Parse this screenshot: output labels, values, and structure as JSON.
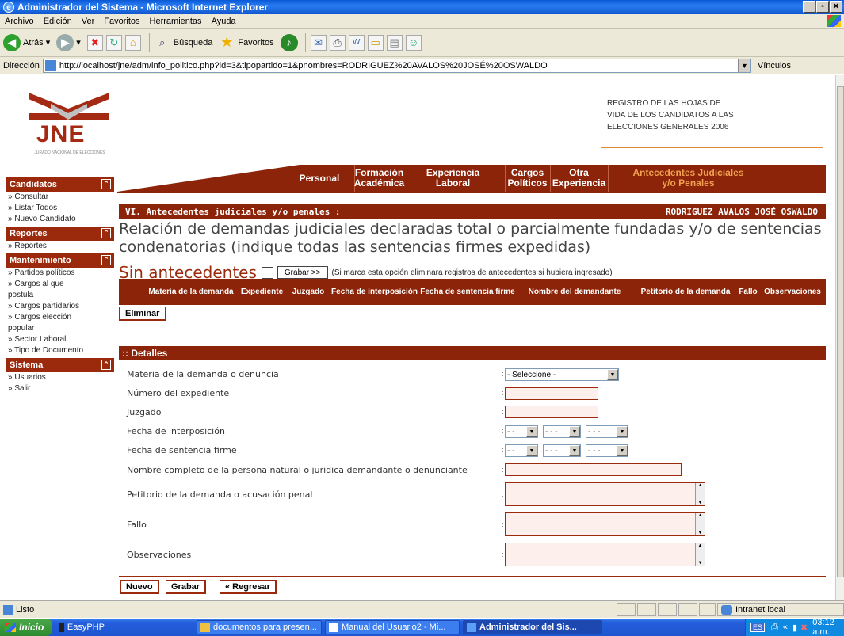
{
  "window": {
    "title": "Administrador del Sistema - Microsoft Internet Explorer"
  },
  "menu": [
    "Archivo",
    "Edición",
    "Ver",
    "Favoritos",
    "Herramientas",
    "Ayuda"
  ],
  "toolbar": {
    "back": "Atrás",
    "search": "Búsqueda",
    "favorites": "Favoritos"
  },
  "address": {
    "label": "Dirección",
    "url": "http://localhost/jne/adm/info_politico.php?id=3&tipopartido=1&pnombres=RODRIGUEZ%20AVALOS%20JOSÉ%20OSWALDO",
    "links": "Vínculos"
  },
  "header": {
    "logo_text": "JNE",
    "logo_sub": "JURADO NACIONAL DE ELECCIONES",
    "registro_1": "REGISTRO DE LAS HOJAS DE",
    "registro_2": "VIDA DE LOS CANDIDATOS A LAS",
    "registro_3": "ELECCIONES GENERALES 2006"
  },
  "sidebar": {
    "candidatos": {
      "title": "Candidatos",
      "items": [
        "» Consultar",
        "» Listar Todos",
        "» Nuevo Candidato"
      ]
    },
    "reportes": {
      "title": "Reportes",
      "items": [
        "» Reportes"
      ]
    },
    "mantenimiento": {
      "title": "Mantenimiento",
      "items": [
        "» Partidos políticos",
        "» Cargos al que",
        "postula",
        "» Cargos partidarios",
        "» Cargos elección",
        "popular",
        "» Sector Laboral",
        "» Tipo de Documento"
      ]
    },
    "sistema": {
      "title": "Sistema",
      "items": [
        "» Usuarios",
        "» Salir"
      ]
    }
  },
  "tabs": {
    "personal": "Personal",
    "formacion_1": "Formación",
    "formacion_2": "Académica",
    "experiencia_1": "Experiencia",
    "experiencia_2": "Laboral",
    "cargos_1": "Cargos",
    "cargos_2": "Políticos",
    "otra_1": "Otra",
    "otra_2": "Experiencia",
    "antecedentes_1": "Antecedentes Judiciales",
    "antecedentes_2": "y/o Penales"
  },
  "section": {
    "title": "VI. Antecedentes judiciales y/o penales :",
    "candidate": "RODRIGUEZ AVALOS JOSÉ OSWALDO",
    "relation_text": "Relación de demandas judiciales declaradas total o parcialmente fundadas y/o de sentencias condenatorias (indique todas las sentencias firmes expedidas)",
    "sin_antecedentes": "Sin antecedentes",
    "grabar_small": "Grabar >>",
    "note": "(Si marca esta opción eliminara registros de antecedentes si hubiera ingresado)"
  },
  "table_headers": {
    "materia": "Materia de la demanda",
    "expediente": "Expediente",
    "juzgado": "Juzgado",
    "fecha_interposicion": "Fecha de interposición",
    "fecha_sentencia": "Fecha de sentencia firme",
    "nombre_demandante": "Nombre del demandante",
    "petitorio": "Petitorio de la demanda",
    "fallo": "Fallo",
    "observaciones": "Observaciones"
  },
  "eliminar": "Eliminar",
  "details": {
    "title": ":: Detalles",
    "materia_label": "Materia de la demanda o denuncia",
    "materia_value": "- Seleccione -",
    "expediente_label": "Número del expediente",
    "juzgado_label": "Juzgado",
    "fecha_interposicion_label": "Fecha de interposición",
    "fecha_sentencia_label": "Fecha de sentencia firme",
    "nombre_label": "Nombre completo de la persona natural o juridica demandante o denunciante",
    "petitorio_label": "Petitorio de la demanda o acusación penal",
    "fallo_label": "Fallo",
    "observaciones_label": "Observaciones",
    "day_value": "- -",
    "month_value": "- - -",
    "year_value": "- - -",
    "colon": ":"
  },
  "buttons": {
    "nuevo": "Nuevo",
    "grabar": "Grabar",
    "regresar": "« Regresar"
  },
  "status": {
    "text": "Listo",
    "zone": "Intranet local"
  },
  "taskbar": {
    "start": "Inicio",
    "easyphp": "EasyPHP",
    "task1": "documentos para presen...",
    "task2": "Manual del Usuario2 - Mi...",
    "task3": "Administrador del Sis...",
    "lang": "ES",
    "time": "03:12 a.m."
  }
}
